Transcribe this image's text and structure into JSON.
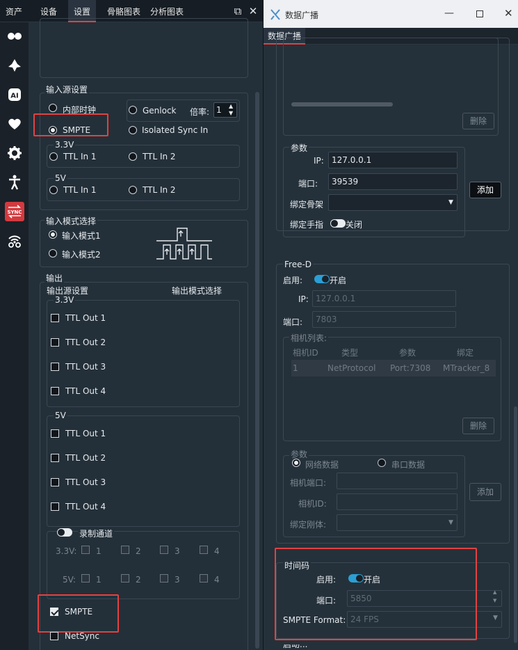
{
  "left": {
    "tabs": [
      "资产",
      "设备",
      "设置",
      "骨骼图表",
      "分析图表"
    ],
    "input_source": {
      "title": "输入源设置",
      "internal_clock": "内部时钟",
      "genlock": "Genlock",
      "multiplier_label": "倍率:",
      "multiplier_value": "1",
      "smpte": "SMPTE",
      "isolated": "Isolated Sync In",
      "v33": "3.3V",
      "ttl_in1": "TTL In 1",
      "ttl_in2": "TTL In 2",
      "v5": "5V"
    },
    "input_mode": {
      "title": "输入模式选择",
      "mode1": "输入模式1",
      "mode2": "输入模式2"
    },
    "output": {
      "title": "输出",
      "source_label": "输出源设置",
      "mode_label": "输出模式选择",
      "v33": "3.3V",
      "v5": "5V",
      "ttl_out": [
        "TTL Out 1",
        "TTL Out 2",
        "TTL Out 3",
        "TTL Out 4"
      ],
      "record_channel": "录制通道",
      "row33": "3.3V:",
      "row5": "5V:",
      "nums": [
        "1",
        "2",
        "3",
        "4"
      ],
      "smpte": "SMPTE",
      "netsync": "NetSync"
    }
  },
  "right": {
    "window_title": "数据广播",
    "tab": "数据广播",
    "top_panel": {
      "delete": "删除"
    },
    "params": {
      "title": "参数",
      "ip_label": "IP:",
      "ip": "127.0.0.1",
      "port_label": "端口:",
      "port": "39539",
      "bind_skeleton": "绑定骨架",
      "bind_finger": "绑定手指",
      "finger_state": "关闭",
      "add": "添加"
    },
    "freed": {
      "title": "Free-D",
      "enable_label": "启用:",
      "enable_state": "开启",
      "ip_label": "IP:",
      "ip": "127.0.0.1",
      "port_label": "端口:",
      "port": "7803",
      "camera_list": "相机列表:",
      "headers": [
        "相机ID",
        "类型",
        "参数",
        "绑定"
      ],
      "row": [
        "1",
        "NetProtocol",
        "Port:7308",
        "MTracker_8"
      ],
      "delete": "删除",
      "param_title": "参数",
      "net_data": "网络数据",
      "serial_data": "串口数据",
      "cam_port": "相机端口:",
      "cam_id": "相机ID:",
      "bind_rigid": "绑定刚体:",
      "add": "添加"
    },
    "timecode": {
      "title": "时间码",
      "enable_label": "启用:",
      "enable_state": "开启",
      "port_label": "端口:",
      "port": "5850",
      "format_label": "SMPTE Format:",
      "format": "24 FPS"
    },
    "bottom_partial": "启动..."
  },
  "colors": {
    "accent_red": "#e34141",
    "toggle_blue": "#2a9fd6",
    "active_sidebar": "#d23a3f"
  }
}
